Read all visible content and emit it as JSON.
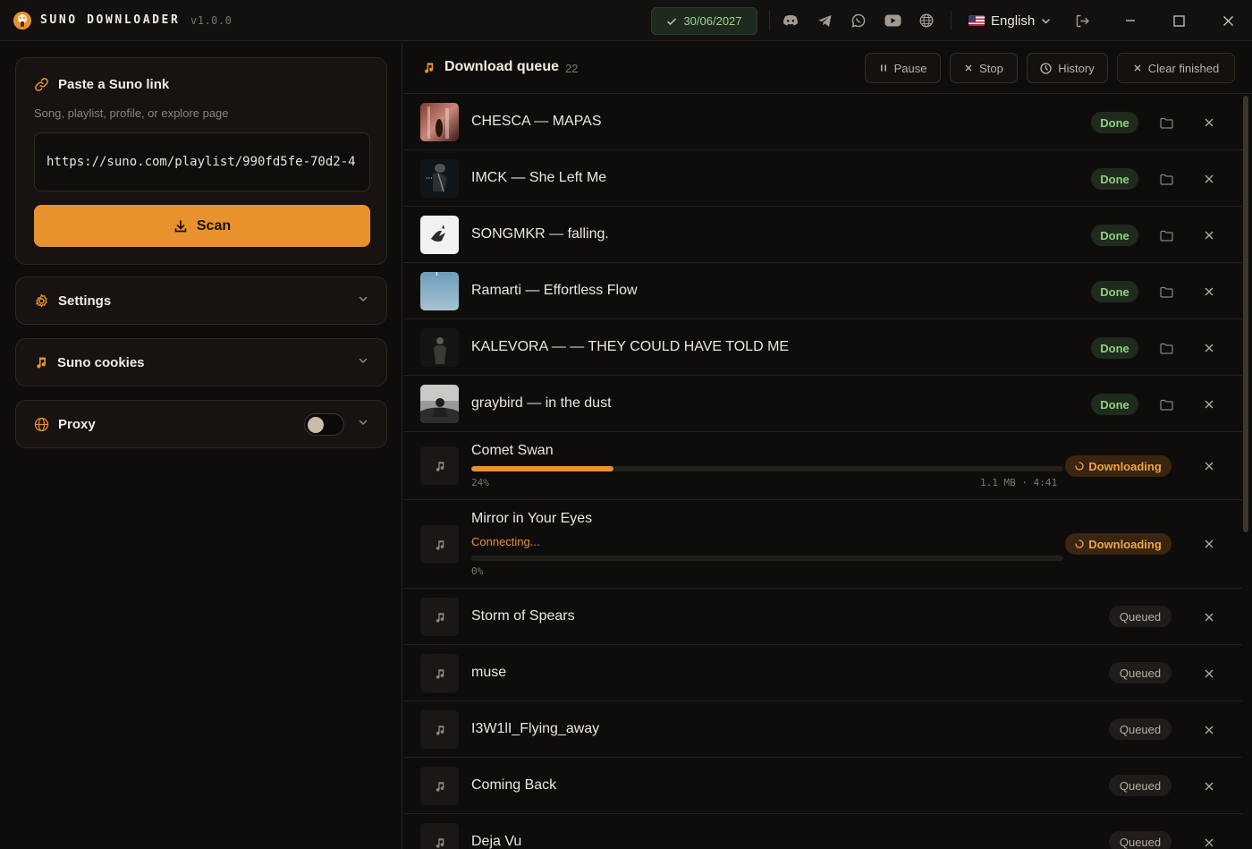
{
  "app": {
    "name": "SUNO DOWNLOADER",
    "version": "v1.0.0"
  },
  "titlebar": {
    "date": "30/06/2027",
    "icons": [
      "discord-icon",
      "telegram-icon",
      "whatsapp-icon",
      "youtube-icon",
      "globe-icon"
    ],
    "language": "English",
    "accent_color": "#e8922e"
  },
  "link_card": {
    "title": "Paste a Suno link",
    "subtitle": "Song, playlist, profile, or explore page",
    "url_value": "https://suno.com/playlist/990fd5fe-70d2-4",
    "scan_label": "Scan"
  },
  "sections": {
    "settings": "Settings",
    "cookies": "Suno cookies",
    "proxy": "Proxy",
    "proxy_enabled": false
  },
  "queue": {
    "title": "Download queue",
    "count": "22",
    "buttons": {
      "pause": "Pause",
      "stop": "Stop",
      "history": "History",
      "clear": "Clear finished"
    },
    "items": [
      {
        "title": "CHESCA — MAPAS",
        "status": "Done"
      },
      {
        "title": "IMCK — She Left Me",
        "status": "Done"
      },
      {
        "title": "SONGMKR — falling.",
        "status": "Done"
      },
      {
        "title": "Ramarti — Effortless Flow",
        "status": "Done"
      },
      {
        "title": "KALEVORA — — THEY COULD HAVE TOLD ME",
        "status": "Done"
      },
      {
        "title": "graybird — in the dust",
        "status": "Done"
      },
      {
        "title": "Comet Swan",
        "status": "Downloading",
        "progress": 0.24,
        "percent_label": "24%",
        "meta": "1.1 MB · 4:41"
      },
      {
        "title": "Mirror in Your Eyes",
        "status": "Downloading",
        "connecting": "Connecting...",
        "progress": 0,
        "percent_label": "0%"
      },
      {
        "title": "Storm of Spears",
        "status": "Queued"
      },
      {
        "title": "muse",
        "status": "Queued"
      },
      {
        "title": "I3W1lI_Flying_away",
        "status": "Queued"
      },
      {
        "title": "Coming Back",
        "status": "Queued"
      },
      {
        "title": "Deja Vu",
        "status": "Queued"
      }
    ]
  }
}
